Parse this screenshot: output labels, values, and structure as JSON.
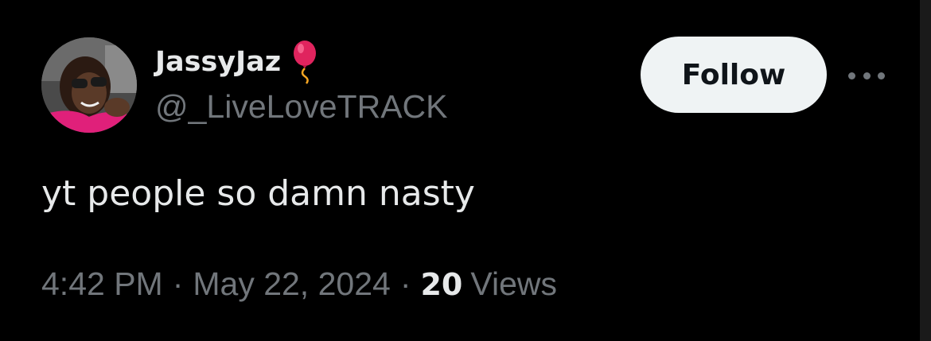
{
  "author": {
    "display_name": "JassyJaz",
    "name_emoji": "balloon-icon",
    "handle": "@_LiveLoveTRACK"
  },
  "actions": {
    "follow_label": "Follow",
    "more_icon": "more-horizontal-icon"
  },
  "tweet": {
    "text": "yt people so damn nasty"
  },
  "meta": {
    "time": "4:42 PM",
    "separator": "·",
    "date": "May 22, 2024",
    "views_count": "20",
    "views_label": "Views"
  },
  "colors": {
    "background": "#000000",
    "primary_text": "#e7e9ea",
    "secondary_text": "#71767b",
    "follow_button_bg": "#eff3f4",
    "follow_button_text": "#0f1419",
    "balloon": "#e0245e"
  }
}
